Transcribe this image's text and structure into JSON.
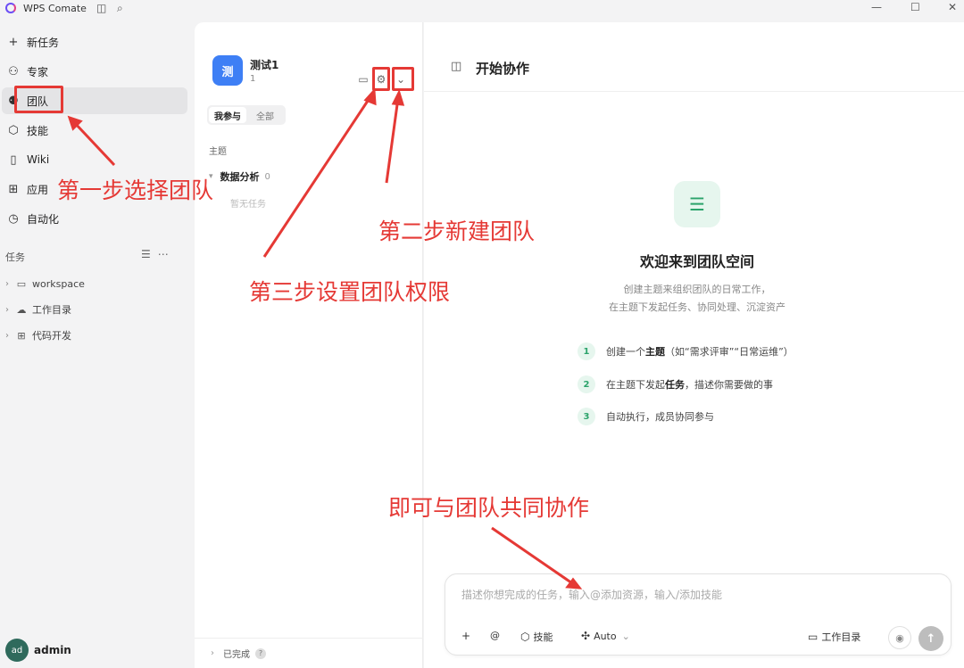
{
  "app": {
    "title": "WPS Comate"
  },
  "sidebar": {
    "nav": [
      {
        "label": "新任务",
        "icon": "plus-icon"
      },
      {
        "label": "专家",
        "icon": "expert-icon"
      },
      {
        "label": "团队",
        "icon": "team-icon"
      },
      {
        "label": "技能",
        "icon": "cube-icon"
      },
      {
        "label": "Wiki",
        "icon": "book-icon"
      },
      {
        "label": "应用",
        "icon": "apps-icon"
      },
      {
        "label": "自动化",
        "icon": "clock-icon"
      }
    ],
    "section_title": "任务",
    "tree": [
      {
        "label": "workspace",
        "icon": "monitor-icon"
      },
      {
        "label": "工作目录",
        "icon": "cloud-icon"
      },
      {
        "label": "代码开发",
        "icon": "apps-icon"
      }
    ],
    "user": {
      "avatar": "ad",
      "name": "admin"
    }
  },
  "team_panel": {
    "logo_text": "测",
    "name": "测试1",
    "count": "1",
    "tabs": [
      "我参与",
      "全部"
    ],
    "topics_label": "主题",
    "topic": {
      "name": "数据分析",
      "count": "0"
    },
    "empty": "暂无任务",
    "footer": {
      "label": "已完成",
      "help": "?"
    }
  },
  "main": {
    "title": "开始协作",
    "welcome_title": "欢迎来到团队空间",
    "welcome_sub": [
      "创建主题来组织团队的日常工作，",
      "在主题下发起任务、协同处理、沉淀资产"
    ],
    "steps": [
      {
        "num": "1",
        "pre": "创建一个",
        "bold": "主题",
        "post": "（如“需求评审”“日常运维”）"
      },
      {
        "num": "2",
        "pre": "在主题下发起",
        "bold": "任务",
        "post": "，描述你需要做的事"
      },
      {
        "num": "3",
        "pre": "自动执行，成员协同参与",
        "bold": "",
        "post": ""
      }
    ],
    "composer": {
      "placeholder": "描述你想完成的任务，输入@添加资源，输入/添加技能",
      "at": "@",
      "skill": "技能",
      "auto": "Auto",
      "workdir": "工作目录"
    }
  },
  "annotations": {
    "step1": "第一步选择团队",
    "step2": "第二步新建团队",
    "step3": "第三步设置团队权限",
    "final": "即可与团队共同协作",
    "color": "#e53935"
  }
}
